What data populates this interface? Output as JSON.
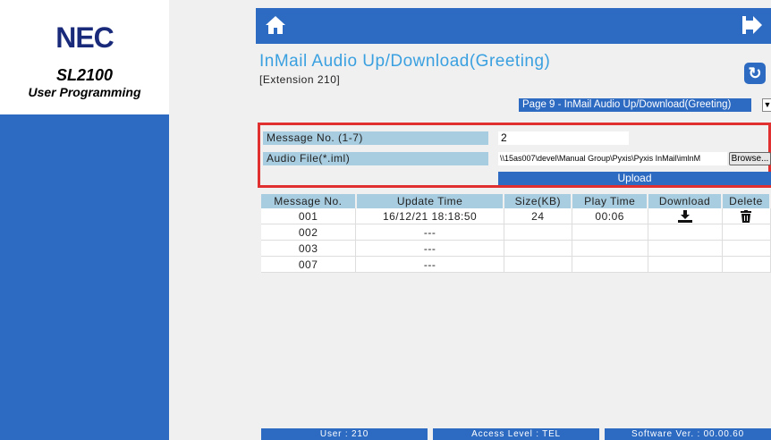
{
  "brand": {
    "logo": "NEC",
    "product": "SL2100",
    "subtitle": "User Programming"
  },
  "header": {
    "title": "InMail Audio Up/Download(Greeting)",
    "extension": "[Extension 210]"
  },
  "page_select": {
    "value": "Page 9 - InMail Audio Up/Download(Greeting)"
  },
  "form": {
    "message_no_label": "Message No. (1-7)",
    "message_no_value": "2",
    "audio_file_label": "Audio File(*.iml)",
    "audio_file_value": "\\\\15as007\\devel\\Manual Group\\Pyxis\\Pyxis InMail\\imlnM",
    "browse_label": "Browse...",
    "upload_label": "Upload"
  },
  "table": {
    "headers": [
      "Message No.",
      "Update Time",
      "Size(KB)",
      "Play Time",
      "Download",
      "Delete"
    ],
    "rows": [
      {
        "no": "001",
        "time": "16/12/21 18:18:50",
        "size": "24",
        "play": "00:06",
        "download": true,
        "delete": true
      },
      {
        "no": "002",
        "time": "---",
        "size": "",
        "play": "",
        "download": false,
        "delete": false
      },
      {
        "no": "003",
        "time": "---",
        "size": "",
        "play": "",
        "download": false,
        "delete": false
      },
      {
        "no": "007",
        "time": "---",
        "size": "",
        "play": "",
        "download": false,
        "delete": false
      }
    ]
  },
  "footer": {
    "user": "User : 210",
    "access": "Access Level : TEL",
    "software": "Software Ver. : 00.00.60"
  },
  "icons": {
    "home": "home-icon",
    "logout": "logout-icon",
    "refresh": "refresh-icon",
    "download": "download-icon",
    "delete": "trash-icon"
  },
  "colors": {
    "primary": "#2d6ac1",
    "header_cell": "#a8cde0",
    "title": "#3aa0e0",
    "highlight": "#e03030"
  }
}
